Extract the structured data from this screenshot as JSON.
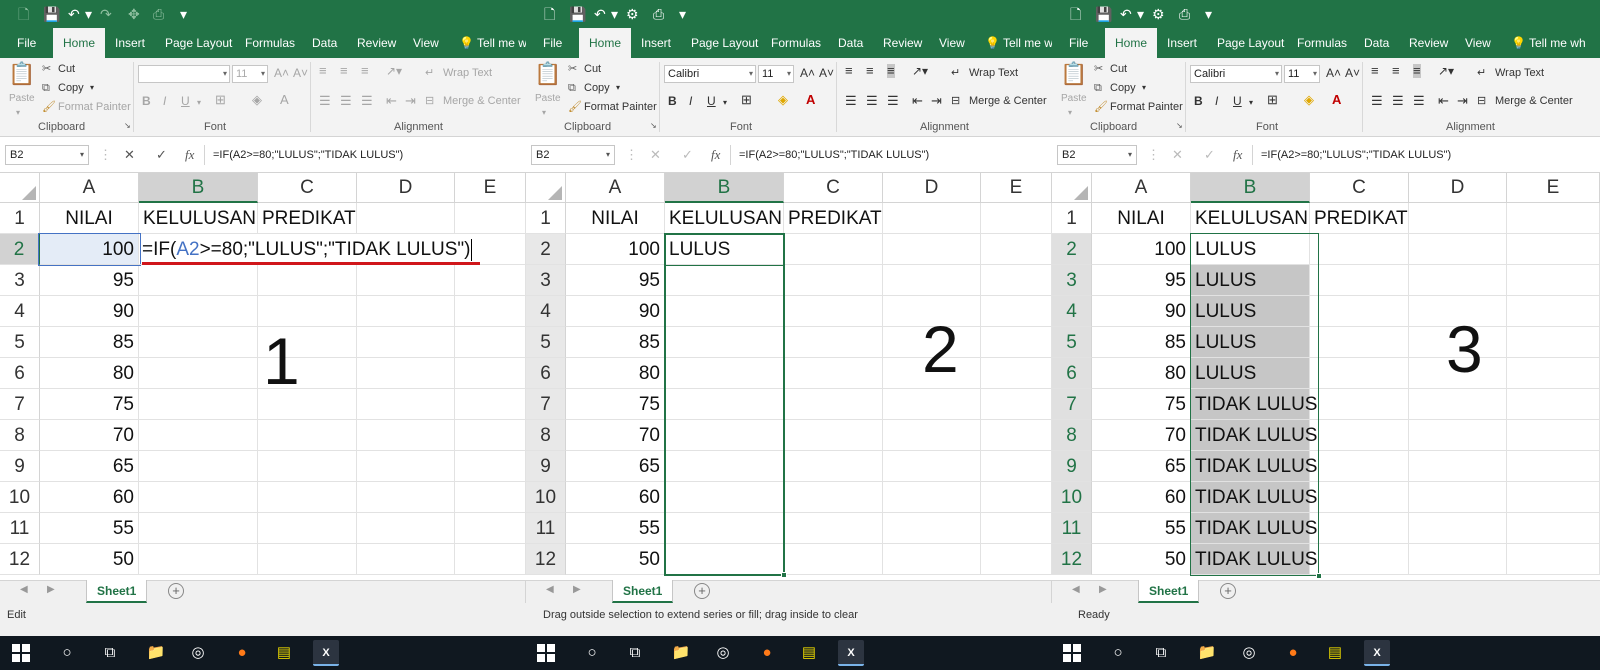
{
  "ribbon": {
    "tabs": [
      "File",
      "Home",
      "Insert",
      "Page Layout",
      "Formulas",
      "Data",
      "Review",
      "View",
      "Tell me wh"
    ],
    "clipboard": {
      "paste": "Paste",
      "cut": "Cut",
      "copy": "Copy",
      "format_painter": "Format Painter",
      "group": "Clipboard"
    },
    "font": {
      "name": "Calibri",
      "size": "11",
      "group": "Font",
      "bold": "B",
      "italic": "I",
      "underline": "U"
    },
    "alignment": {
      "wrap": "Wrap Text",
      "merge": "Merge & Center",
      "group": "Alignment"
    }
  },
  "formula": {
    "namebox": "B2",
    "cancel": "✕",
    "enter": "✓",
    "fx": "fx",
    "text": "=IF(A2>=80;\"LULUS\";\"TIDAK LULUS\")"
  },
  "columns": [
    "A",
    "B",
    "C",
    "D",
    "E"
  ],
  "row_numbers": [
    "1",
    "2",
    "3",
    "4",
    "5",
    "6",
    "7",
    "8",
    "9",
    "10",
    "11",
    "12"
  ],
  "headers": {
    "a": "NILAI",
    "b": "KELULUSAN",
    "c": "PREDIKAT"
  },
  "nilai": [
    "100",
    "95",
    "90",
    "85",
    "80",
    "75",
    "70",
    "65",
    "60",
    "55",
    "50"
  ],
  "panels": [
    {
      "label": "1",
      "edit_parts": [
        "=IF(",
        "A2",
        ">=80;\"LULUS\";\"TIDAK LULUS\")"
      ],
      "kelulusan": [
        "",
        "",
        "",
        "",
        "",
        "",
        "",
        "",
        "",
        "",
        ""
      ],
      "status": "Edit"
    },
    {
      "label": "2",
      "kelulusan": [
        "LULUS",
        "",
        "",
        "",
        "",
        "",
        "",
        "",
        "",
        "",
        ""
      ],
      "status": "Drag outside selection to extend series or fill; drag inside to clear"
    },
    {
      "label": "3",
      "kelulusan": [
        "LULUS",
        "LULUS",
        "LULUS",
        "LULUS",
        "LULUS",
        "TIDAK LULUS",
        "TIDAK LULUS",
        "TIDAK LULUS",
        "TIDAK LULUS",
        "TIDAK LULUS",
        "TIDAK LULUS"
      ],
      "status": "Ready"
    }
  ],
  "sheet_tab": "Sheet1",
  "add_sheet": "+",
  "colors": {
    "excel_green": "#217346",
    "selection_fill": "#c6c6c6",
    "edit_highlight": "#e4ecf7",
    "taskbar": "#101820"
  }
}
